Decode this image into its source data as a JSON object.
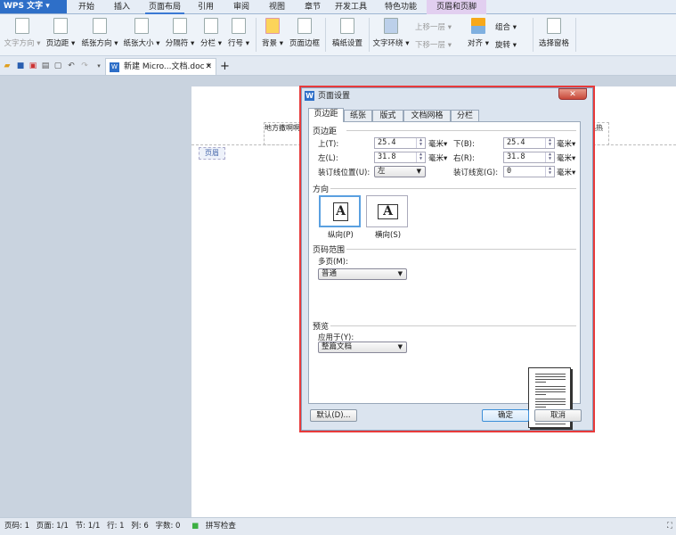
{
  "app": {
    "logo": "WPS 文字"
  },
  "menu": {
    "tabs": [
      {
        "label": "开始"
      },
      {
        "label": "插入"
      },
      {
        "label": "页面布局",
        "active": true
      },
      {
        "label": "引用"
      },
      {
        "label": "审阅"
      },
      {
        "label": "视图"
      },
      {
        "label": "章节"
      },
      {
        "label": "开发工具"
      },
      {
        "label": "特色功能"
      },
      {
        "label": "页眉和页脚",
        "highlight": true
      }
    ]
  },
  "ribbon": {
    "items": [
      {
        "label": "文字方向 ▾",
        "disabled": true
      },
      {
        "label": "页边距 ▾"
      },
      {
        "label": "纸张方向 ▾"
      },
      {
        "label": "纸张大小 ▾"
      },
      {
        "label": "分隔符 ▾"
      },
      {
        "label": "分栏 ▾"
      },
      {
        "label": "行号 ▾"
      },
      {
        "label": "背景 ▾"
      },
      {
        "label": "页面边框"
      },
      {
        "label": "稿纸设置"
      },
      {
        "label": "文字环绕 ▾"
      },
      {
        "label": "上移一层 ▾",
        "disabled": true
      },
      {
        "label": "下移一层 ▾",
        "disabled": true
      },
      {
        "label": "对齐 ▾"
      },
      {
        "label": "组合 ▾"
      },
      {
        "label": "旋转 ▾"
      },
      {
        "label": "选择窗格"
      }
    ]
  },
  "quickbar": {
    "icons": [
      "open-folder-icon",
      "save-icon",
      "export-pdf-icon",
      "print-icon",
      "print-preview-icon",
      "undo-icon",
      "redo-icon",
      "dropdown-icon"
    ]
  },
  "doc_tab": {
    "title": "新建 Micro...文档.doc *",
    "close": "✕",
    "new_tab": "+"
  },
  "document": {
    "header_label": "页眉",
    "header_text_left": "地方撒啊啊热热热热热热",
    "header_text_right": "热热"
  },
  "dialog": {
    "title": "页面设置",
    "close": "✕",
    "tabs": [
      {
        "label": "页边距",
        "active": true
      },
      {
        "label": "纸张"
      },
      {
        "label": "版式"
      },
      {
        "label": "文档网格"
      },
      {
        "label": "分栏"
      }
    ],
    "margins": {
      "section": "页边距",
      "top": {
        "label": "上(T):",
        "value": "25.4",
        "unit": "毫米▾"
      },
      "bottom": {
        "label": "下(B):",
        "value": "25.4",
        "unit": "毫米▾"
      },
      "left": {
        "label": "左(L):",
        "value": "31.8",
        "unit": "毫米▾"
      },
      "right": {
        "label": "右(R):",
        "value": "31.8",
        "unit": "毫米▾"
      },
      "gutter_pos": {
        "label": "装订线位置(U):",
        "value": "左"
      },
      "gutter": {
        "label": "装订线宽(G):",
        "value": "0",
        "unit": "毫米▾"
      }
    },
    "orientation": {
      "section": "方向",
      "portrait": "纵向(P)",
      "landscape": "横向(S)",
      "selected": "portrait",
      "glyph": "A"
    },
    "pages": {
      "section": "页码范围",
      "label": "多页(M):",
      "value": "普通"
    },
    "preview": {
      "section": "预览",
      "apply_label": "应用于(Y):",
      "apply_value": "整篇文档"
    },
    "buttons": {
      "default": "默认(D)...",
      "ok": "确定",
      "cancel": "取消"
    }
  },
  "status": {
    "items": [
      "页码: 1",
      "页面: 1/1",
      "节: 1/1",
      "行: 1",
      "列: 6",
      "字数: 0"
    ],
    "spell": "拼写检查",
    "spell_color": "#3cb043"
  }
}
